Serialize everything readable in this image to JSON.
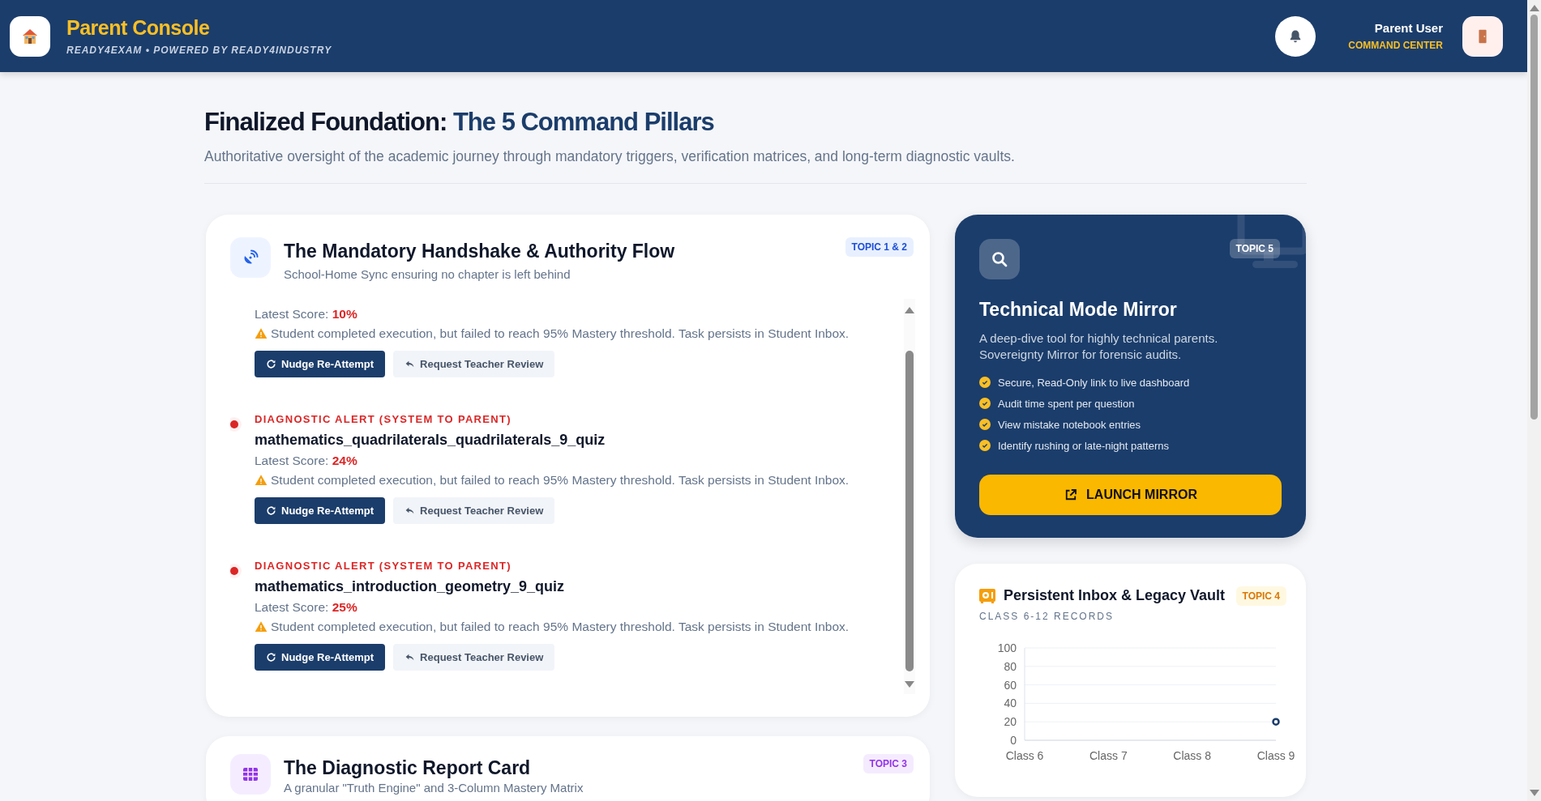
{
  "header": {
    "brand": "Parent Console",
    "tagline": "READY4EXAM • POWERED BY READY4INDUSTRY",
    "user_name": "Parent User",
    "user_role": "COMMAND CENTER"
  },
  "intro": {
    "title_lead": "Finalized Foundation:",
    "title_accent": "The 5 Command Pillars",
    "description": "Authoritative oversight of the academic journey through mandatory triggers, verification matrices, and long-term diagnostic vaults."
  },
  "handshake_card": {
    "title": "The Mandatory Handshake & Authority Flow",
    "subtitle": "School-Home Sync ensuring no chapter is left behind",
    "badge": "TOPIC 1 & 2",
    "alerts": [
      {
        "score_label": "Latest Score:",
        "score": "10%",
        "message": "Student completed execution, but failed to reach 95% Mastery threshold. Task persists in Student Inbox.",
        "actions": [
          "Nudge Re-Attempt",
          "Request Teacher Review"
        ]
      },
      {
        "label": "DIAGNOSTIC ALERT (SYSTEM TO PARENT)",
        "title": "mathematics_quadrilaterals_quadrilaterals_9_quiz",
        "score_label": "Latest Score:",
        "score": "24%",
        "message": "Student completed execution, but failed to reach 95% Mastery threshold. Task persists in Student Inbox.",
        "actions": [
          "Nudge Re-Attempt",
          "Request Teacher Review"
        ]
      },
      {
        "label": "DIAGNOSTIC ALERT (SYSTEM TO PARENT)",
        "title": "mathematics_introduction_geometry_9_quiz",
        "score_label": "Latest Score:",
        "score": "25%",
        "message": "Student completed execution, but failed to reach 95% Mastery threshold. Task persists in Student Inbox.",
        "actions": [
          "Nudge Re-Attempt",
          "Request Teacher Review"
        ]
      }
    ]
  },
  "report_card": {
    "title": "The Diagnostic Report Card",
    "subtitle": "A granular \"Truth Engine\" and 3-Column Mastery Matrix",
    "badge": "TOPIC 3"
  },
  "mirror_card": {
    "badge": "TOPIC 5",
    "title": "Technical Mode Mirror",
    "description": "A deep-dive tool for highly technical parents. Sovereignty Mirror for forensic audits.",
    "features": [
      "Secure, Read-Only link to live dashboard",
      "Audit time spent per question",
      "View mistake notebook entries",
      "Identify rushing or late-night patterns"
    ],
    "button": "LAUNCH MIRROR"
  },
  "vault_card": {
    "title": "Persistent Inbox & Legacy Vault",
    "badge": "TOPIC 4",
    "caption": "CLASS 6-12 RECORDS",
    "chart_data": {
      "type": "line",
      "categories": [
        "Class 6",
        "Class 7",
        "Class 8",
        "Class 9"
      ],
      "series": [
        {
          "color": "#1b3d6b",
          "marker": "circle",
          "values": [
            null,
            null,
            null,
            20
          ]
        }
      ],
      "grid": true,
      "ylim": [
        0,
        100
      ],
      "yticks": [
        0,
        20,
        40,
        60,
        80,
        100
      ]
    }
  }
}
